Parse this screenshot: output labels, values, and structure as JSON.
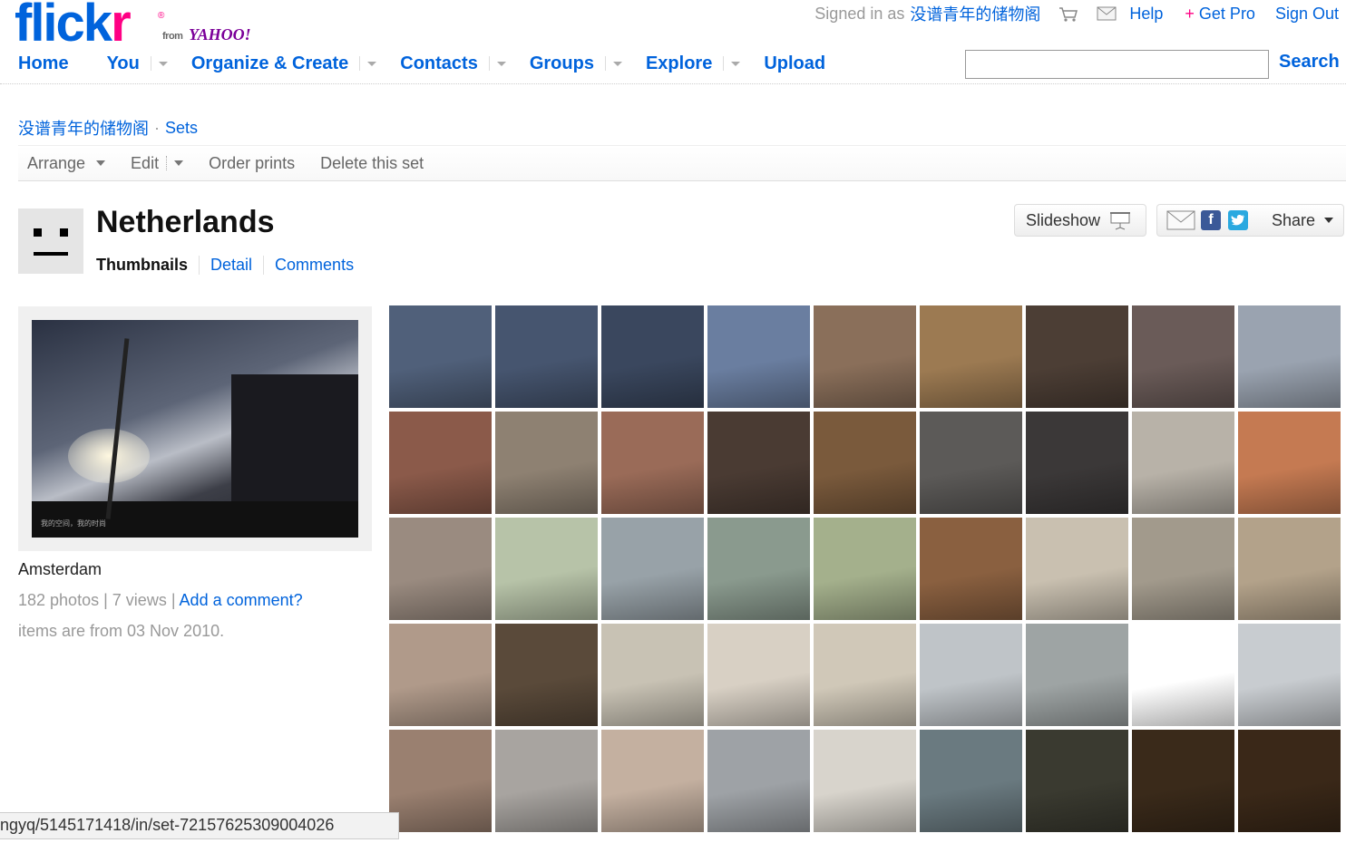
{
  "logo": {
    "text_a": "flick",
    "text_b": "r",
    "reg": "®",
    "from": "from",
    "yahoo": "YAHOO!"
  },
  "topbar": {
    "signed_in_as": "Signed in as",
    "username": "没谱青年的储物阁",
    "help": "Help",
    "get_pro_plus": "+",
    "get_pro": "Get Pro",
    "sign_out": "Sign Out"
  },
  "nav": [
    "Home",
    "You",
    "Organize & Create",
    "Contacts",
    "Groups",
    "Explore",
    "Upload"
  ],
  "search": {
    "value": "",
    "button": "Search"
  },
  "breadcrumb": {
    "user": "没谱青年的储物阁",
    "sep": "·",
    "sets": "Sets"
  },
  "subnav": {
    "arrange": "Arrange",
    "edit": "Edit",
    "order_prints": "Order prints",
    "delete_set": "Delete this set"
  },
  "set": {
    "title": "Netherlands",
    "tabs": [
      "Thumbnails",
      "Detail",
      "Comments"
    ],
    "slideshow": "Slideshow",
    "share": "Share",
    "description": "Amsterdam",
    "photos": "182 photos",
    "stat_sep": "|",
    "views": "7 views",
    "add_comment": "Add a comment?",
    "dates": "items are from 03 Nov 2010."
  },
  "cover_watermark": "我的空间，我的时尚",
  "colors": {
    "flickr_blue": "#0063dc",
    "flickr_pink": "#ff0084",
    "yahoo_purple": "#7b0099"
  },
  "thumbs": [
    "#50607a",
    "#46556f",
    "#3a475e",
    "#6a7ea0",
    "#8a6f5a",
    "#9c7a52",
    "#4c3e35",
    "#6a5b58",
    "#9aa3b0",
    "#8b5a4a",
    "#8e8172",
    "#9a6b58",
    "#4a3b33",
    "#7a5a3c",
    "#5c5a58",
    "#3b3838",
    "#b8b2a8",
    "#c57a52",
    "#9a8b80",
    "#b7c3a8",
    "#98a2a8",
    "#8a9a8e",
    "#a4b08c",
    "#8a6040",
    "#c9c0b0",
    "#a29a8c",
    "#b3a28a",
    "#b09a8a",
    "#5a4a3a",
    "#c8c2b4",
    "#d8d0c4",
    "#d0c8b8",
    "#bfc4c8",
    "#9ea4a4",
    "#ffffff",
    "#c8ccd0",
    "#9a8070",
    "#a8a4a0",
    "#c4b0a0",
    "#9ea2a6",
    "#d8d4cc",
    "#6a7a80",
    "#3a3a30",
    "#3a2a1a",
    "#3a2818"
  ],
  "statusbar": "ngyq/5145171418/in/set-72157625309004026"
}
